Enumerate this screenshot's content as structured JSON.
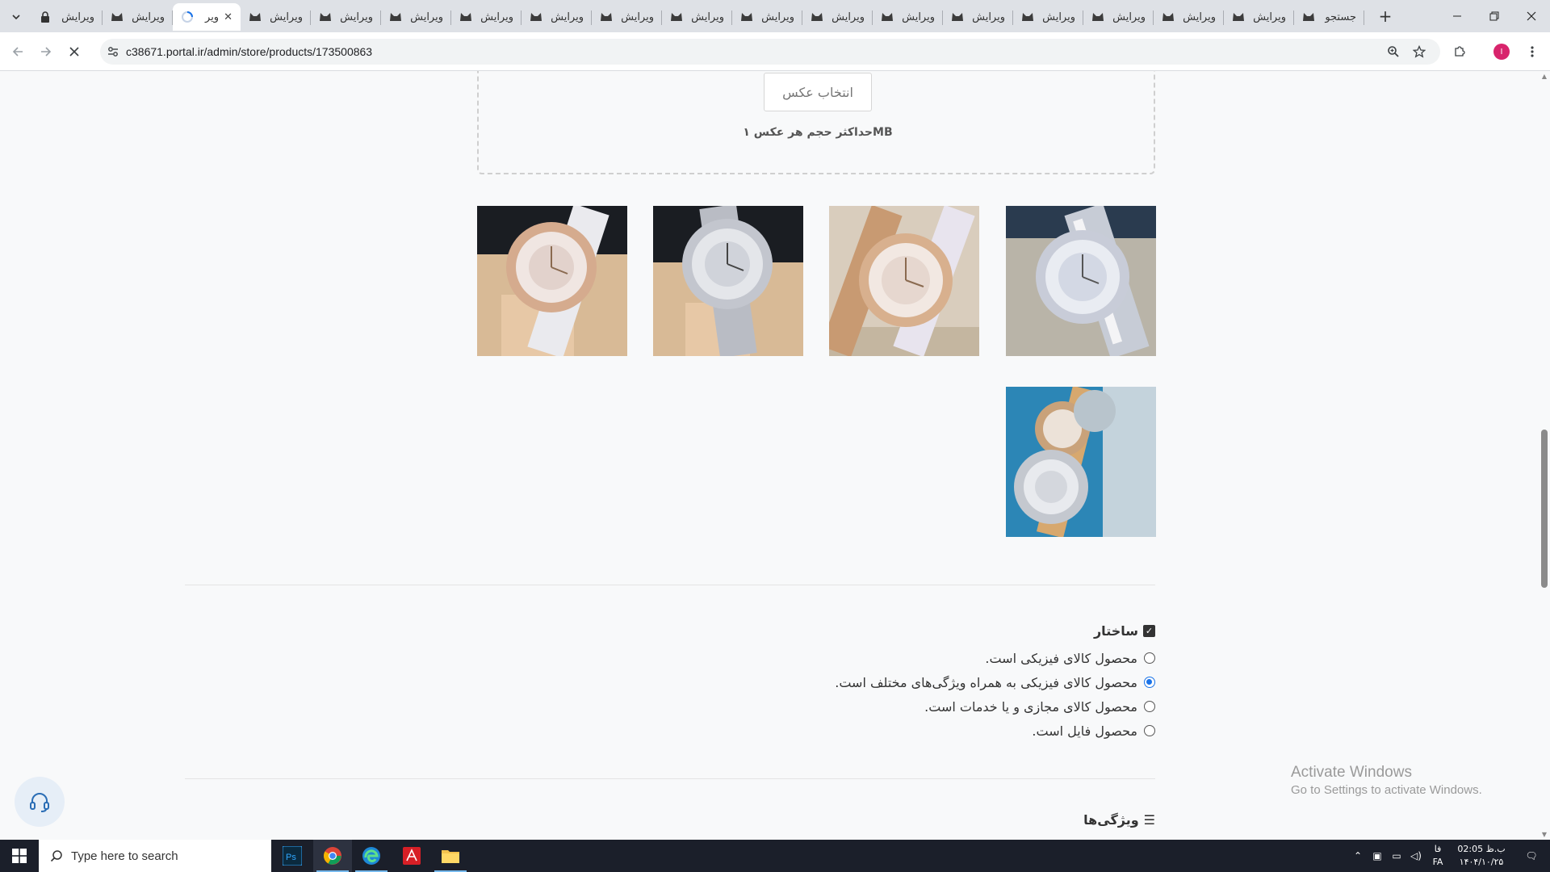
{
  "tabs": [
    {
      "label": "ویرایش",
      "icon": "lock-icon"
    },
    {
      "label": "ویرایش",
      "icon": "cat-icon"
    },
    {
      "label": "ویر",
      "icon": "loading-icon",
      "active": true
    },
    {
      "label": "ویرایش",
      "icon": "cat-icon"
    },
    {
      "label": "ویرایش",
      "icon": "cat-icon"
    },
    {
      "label": "ویرایش",
      "icon": "cat-icon"
    },
    {
      "label": "ویرایش",
      "icon": "cat-icon"
    },
    {
      "label": "ویرایش",
      "icon": "cat-icon"
    },
    {
      "label": "ویرایش",
      "icon": "cat-icon"
    },
    {
      "label": "ویرایش",
      "icon": "cat-icon"
    },
    {
      "label": "ویرایش",
      "icon": "cat-icon"
    },
    {
      "label": "ویرایش",
      "icon": "cat-icon"
    },
    {
      "label": "ویرایش",
      "icon": "cat-icon"
    },
    {
      "label": "ویرایش",
      "icon": "cat-icon"
    },
    {
      "label": "ویرایش",
      "icon": "cat-icon"
    },
    {
      "label": "ویرایش",
      "icon": "cat-icon"
    },
    {
      "label": "ویرایش",
      "icon": "cat-icon"
    },
    {
      "label": "ویرایش",
      "icon": "cat-icon"
    },
    {
      "label": "جستجو",
      "icon": "cat-icon"
    }
  ],
  "address": {
    "url": "c38671.portal.ir/admin/store/products/173500863"
  },
  "upload": {
    "button_label": "انتخاب عکس",
    "hint": "حداکثر حجم هر عکس ۱MB"
  },
  "images": [
    {
      "desc": "watch-1",
      "tone": "#2a3b4f"
    },
    {
      "desc": "watch-2",
      "tone": "#c9c4b8"
    },
    {
      "desc": "watch-3",
      "tone": "#d9cdbd"
    },
    {
      "desc": "watch-4",
      "tone": "#1a1d22"
    },
    {
      "desc": "watch-5",
      "tone": "#2c86b6"
    }
  ],
  "structure": {
    "title": "ساختار",
    "options": [
      {
        "label": "محصول کالای فیزیکی است.",
        "checked": false
      },
      {
        "label": "محصول کالای فیزیکی به همراه ویژگی‌های مختلف است.",
        "checked": true
      },
      {
        "label": "محصول کالای مجازی و یا خدمات است.",
        "checked": false
      },
      {
        "label": "محصول فایل است.",
        "checked": false
      }
    ]
  },
  "features": {
    "title": "ویژگی‌ها"
  },
  "watermark": {
    "title": "Activate Windows",
    "subtitle": "Go to Settings to activate Windows."
  },
  "taskbar": {
    "search_placeholder": "Type here to search",
    "lang_top": "فا",
    "lang_bottom": "FA",
    "time": "02:05 ب.ظ",
    "date": "۱۴۰۴/۱۰/۲۵"
  },
  "colors": {
    "accent": "#1a73e8",
    "profile": "#d8246c",
    "taskbar": "#1b1f2a"
  }
}
